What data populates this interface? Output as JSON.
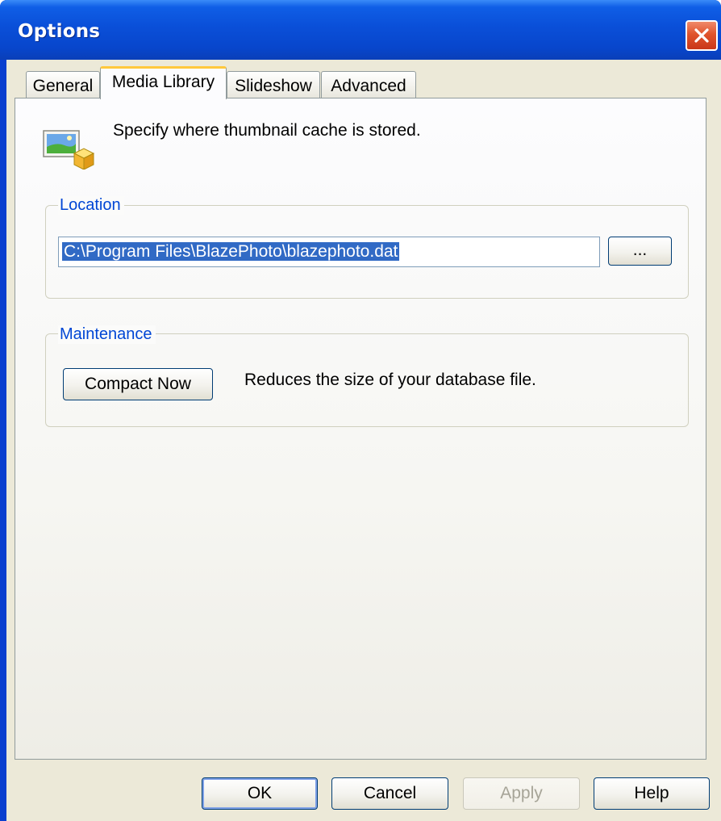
{
  "window": {
    "title": "Options"
  },
  "tabs": [
    {
      "label": "General",
      "active": false
    },
    {
      "label": "Media Library",
      "active": true
    },
    {
      "label": "Slideshow",
      "active": false
    },
    {
      "label": "Advanced",
      "active": false
    }
  ],
  "media_library": {
    "header_text": "Specify where thumbnail cache is stored.",
    "location": {
      "group_label": "Location",
      "path_value": "C:\\Program Files\\BlazePhoto\\blazephoto.dat",
      "browse_label": "..."
    },
    "maintenance": {
      "group_label": "Maintenance",
      "compact_label": "Compact Now",
      "compact_description": "Reduces the size of your database file."
    }
  },
  "buttons": {
    "ok": "OK",
    "cancel": "Cancel",
    "apply": "Apply",
    "help": "Help"
  },
  "colors": {
    "titlebar": "#0a4fd8",
    "dialog_face": "#ece9d8",
    "group_label": "#0046d5",
    "selection": "#316ac5",
    "active_tab_highlight": "#ffc83c",
    "close_button": "#e0542c"
  },
  "icons": {
    "close": "close-icon",
    "media_library": "media-library-icon"
  }
}
